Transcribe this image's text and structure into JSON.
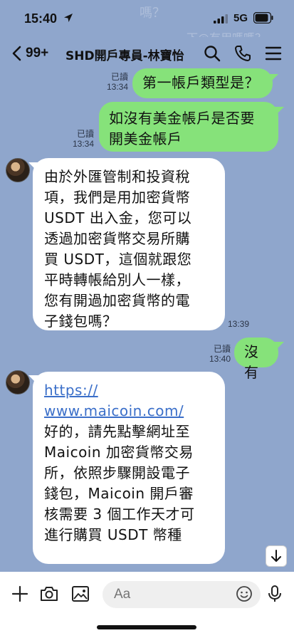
{
  "status": {
    "time": "15:40",
    "network": "5G"
  },
  "background_ghost_text": [
    "嗎？",
    "下@有用嗎嗎？"
  ],
  "header": {
    "unread": "99+",
    "title": "SHD開戶專員-林寶怡"
  },
  "messages": [
    {
      "dir": "out",
      "read": "已讀",
      "time": "13:34",
      "lines": [
        "第一帳戶類型是？"
      ]
    },
    {
      "dir": "out",
      "read": "已讀",
      "time": "13:34",
      "lines": [
        "如沒有美金帳戶是否要",
        "開美金帳戶"
      ]
    },
    {
      "dir": "in",
      "time": "13:39",
      "lines": [
        "由於外匯管制和投資稅",
        "項，我們是用加密貨幣",
        "USDT 出入金，您可以",
        "透過加密貨幣交易所購",
        "買 USDT，這個就跟您",
        "平時轉帳給別人一樣，",
        "您有開過加密貨幣的電",
        "子錢包嗎？"
      ]
    },
    {
      "dir": "out",
      "read": "已讀",
      "time": "13:40",
      "lines": [
        "沒有"
      ]
    },
    {
      "dir": "in",
      "link_lines": [
        "https://",
        "www.maicoin.com/"
      ],
      "lines": [
        "好的，請先點擊網址至",
        "Maicoin 加密貨幣交易",
        "所，依照步驟開設電子",
        "錢包，Maicoin 開戶審",
        "核需要 3 個工作天才可",
        "進行購買 USDT 幣種"
      ]
    }
  ],
  "input": {
    "placeholder": "Aa"
  },
  "colors": {
    "background": "#8fa6cc",
    "outgoing_bubble": "#86e27a",
    "incoming_bubble": "#ffffff",
    "link": "#3b6fc9"
  },
  "icons": [
    "location-arrow-icon",
    "signal-icon",
    "battery-icon",
    "chevron-left-icon",
    "search-icon",
    "phone-icon",
    "menu-icon",
    "chevron-down-icon",
    "plus-icon",
    "camera-icon",
    "image-icon",
    "emoji-icon",
    "microphone-icon"
  ]
}
